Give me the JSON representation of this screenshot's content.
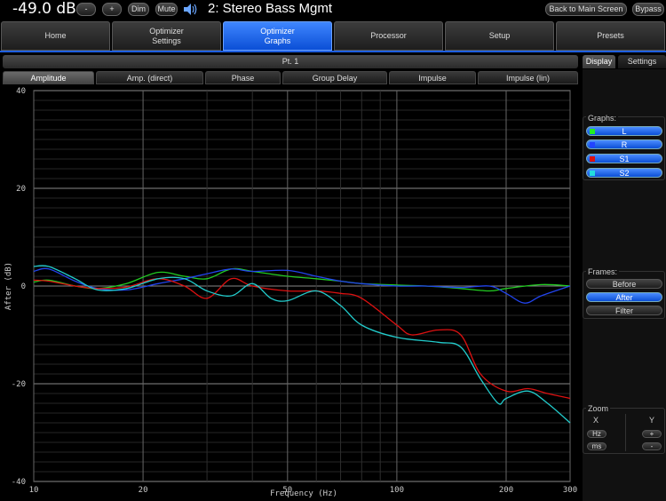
{
  "topbar": {
    "volume": "-49.0 dB",
    "minus": "-",
    "plus": "+",
    "dim": "Dim",
    "mute": "Mute",
    "preset": "2: Stereo Bass Mgmt",
    "back": "Back to Main Screen",
    "bypass": "Bypass"
  },
  "tabs": [
    {
      "label": "Home"
    },
    {
      "label": "Optimizer\nSettings"
    },
    {
      "label": "Optimizer\nGraphs",
      "active": true
    },
    {
      "label": "Processor"
    },
    {
      "label": "Setup"
    },
    {
      "label": "Presets"
    }
  ],
  "point": "Pt. 1",
  "subtabs": [
    "Amplitude",
    "Amp. (direct)",
    "Phase",
    "Group Delay",
    "Impulse",
    "Impulse (lin)"
  ],
  "right_tabs": {
    "display": "Display",
    "settings": "Settings"
  },
  "graphs": {
    "label": "Graphs:",
    "items": [
      {
        "label": "L",
        "color": "#22dd22"
      },
      {
        "label": "R",
        "color": "#2244ff"
      },
      {
        "label": "S1",
        "color": "#dd1111"
      },
      {
        "label": "S2",
        "color": "#22dddd"
      }
    ]
  },
  "frames": {
    "label": "Frames:",
    "items": [
      {
        "label": "Before",
        "active": false
      },
      {
        "label": "After",
        "active": true
      },
      {
        "label": "Filter",
        "active": false
      }
    ]
  },
  "zoom": {
    "label": "Zoom",
    "x": "X",
    "y": "Y",
    "hz": "Hz",
    "ms": "ms",
    "plus": "+",
    "minus": "-"
  },
  "chart_data": {
    "type": "line",
    "xlabel": "Frequency (Hz)",
    "ylabel": "After (dB)",
    "xscale": "log",
    "xlim": [
      10,
      300
    ],
    "ylim": [
      -40,
      40
    ],
    "xticks": [
      10,
      20,
      50,
      100,
      200,
      300
    ],
    "yticks": [
      40,
      20,
      0,
      -20,
      -40
    ],
    "series": [
      {
        "name": "L",
        "color": "#22cc22",
        "x": [
          10,
          11,
          13,
          15,
          18,
          22,
          26,
          30,
          35,
          40,
          50,
          60,
          70,
          80,
          100,
          120,
          150,
          180,
          200,
          250,
          300
        ],
        "y": [
          0.8,
          1.2,
          0,
          -0.5,
          0.5,
          2.8,
          2.0,
          1.5,
          3.5,
          3.0,
          2.0,
          1.5,
          1.0,
          0.5,
          0.2,
          0,
          -0.5,
          -1.0,
          -0.5,
          0.3,
          0
        ]
      },
      {
        "name": "R",
        "color": "#2244ee",
        "x": [
          10,
          11,
          13,
          15,
          18,
          22,
          26,
          30,
          35,
          40,
          50,
          60,
          70,
          80,
          100,
          120,
          150,
          180,
          200,
          225,
          250,
          300
        ],
        "y": [
          3.0,
          3.5,
          1.0,
          -0.5,
          -0.8,
          0.5,
          1.5,
          2.5,
          3.5,
          3.0,
          3.2,
          2.0,
          1.0,
          0.5,
          0,
          0,
          -0.3,
          0,
          -1.5,
          -3.5,
          -2.0,
          0
        ]
      },
      {
        "name": "S1",
        "color": "#dd1111",
        "x": [
          10,
          11,
          13,
          15,
          18,
          22,
          26,
          30,
          35,
          40,
          50,
          60,
          70,
          80,
          100,
          110,
          130,
          150,
          170,
          200,
          230,
          260,
          300
        ],
        "y": [
          1.2,
          1.0,
          0,
          -0.5,
          -0.2,
          1.5,
          0,
          -2.5,
          1.5,
          0,
          -1.0,
          -1.0,
          -1.5,
          -2.5,
          -8.0,
          -10.0,
          -9.0,
          -10.0,
          -18.0,
          -21.5,
          -21.0,
          -22.0,
          -23.0
        ]
      },
      {
        "name": "S2",
        "color": "#22cccc",
        "x": [
          10,
          11,
          13,
          15,
          18,
          22,
          26,
          30,
          35,
          40,
          45,
          50,
          60,
          70,
          80,
          100,
          130,
          150,
          170,
          190,
          200,
          230,
          260,
          300
        ],
        "y": [
          4.0,
          4.0,
          1.5,
          -0.8,
          -0.5,
          1.5,
          1.5,
          -1.0,
          -2.0,
          0.5,
          -2.5,
          -3.0,
          -1.0,
          -4.0,
          -8.0,
          -10.5,
          -11.5,
          -12.5,
          -19.0,
          -24.0,
          -23.0,
          -21.5,
          -24.0,
          -28.0
        ]
      }
    ]
  }
}
